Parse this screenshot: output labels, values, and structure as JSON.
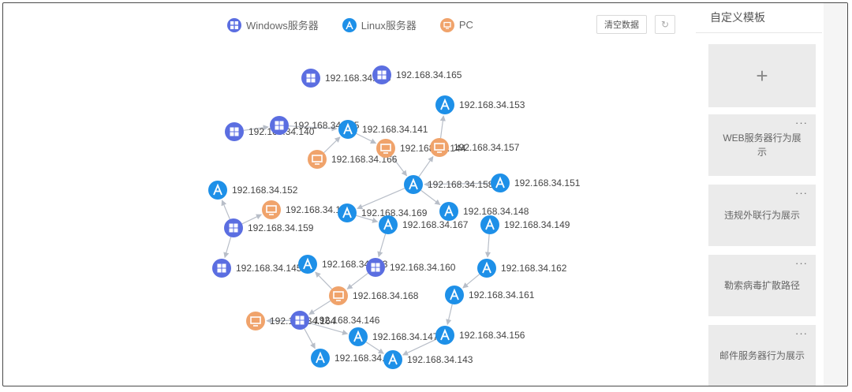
{
  "legend": {
    "windows": "Windows服务器",
    "linux": "Linux服务器",
    "pc": "PC"
  },
  "toolbar": {
    "clear_label": "清空数据",
    "refresh_icon": "refresh-icon"
  },
  "colors": {
    "windows": "#5b6ee1",
    "linux": "#1e90e8",
    "pc": "#f0a36b",
    "edge": "#b8bec8"
  },
  "sidebar": {
    "title": "自定义模板",
    "add_icon": "plus-icon",
    "more_icon": "ellipsis-icon",
    "templates": [
      "WEB服务器行为展示",
      "违规外联行为展示",
      "勒索病毒扩散路径",
      "邮件服务器行为展示"
    ]
  },
  "graph": {
    "nodes": [
      {
        "id": "n1",
        "type": "windows",
        "label": "192.168.34.165"
      },
      {
        "id": "n2",
        "type": "windows",
        "label": "192.168.34.165"
      },
      {
        "id": "n3",
        "type": "linux",
        "label": "192.168.34.153"
      },
      {
        "id": "n4",
        "type": "windows",
        "label": "192.168.34.140"
      },
      {
        "id": "n5",
        "type": "windows",
        "label": "192.168.34.155"
      },
      {
        "id": "n6",
        "type": "linux",
        "label": "192.168.34.141"
      },
      {
        "id": "n7",
        "type": "pc",
        "label": "192.168.34.166"
      },
      {
        "id": "n8",
        "type": "pc",
        "label": "192.168.34.144"
      },
      {
        "id": "n9",
        "type": "pc",
        "label": "192.168.34.157"
      },
      {
        "id": "n10",
        "type": "linux",
        "label": "192.168.34.152"
      },
      {
        "id": "n11",
        "type": "linux",
        "label": "192.168.34.158"
      },
      {
        "id": "n12",
        "type": "linux",
        "label": "192.168.34.151"
      },
      {
        "id": "n13",
        "type": "pc",
        "label": "192.168.34.142"
      },
      {
        "id": "n14",
        "type": "linux",
        "label": "192.168.34.169"
      },
      {
        "id": "n15",
        "type": "linux",
        "label": "192.168.34.148"
      },
      {
        "id": "n16",
        "type": "windows",
        "label": "192.168.34.159"
      },
      {
        "id": "n17",
        "type": "linux",
        "label": "192.168.34.167"
      },
      {
        "id": "n18",
        "type": "linux",
        "label": "192.168.34.149"
      },
      {
        "id": "n19",
        "type": "windows",
        "label": "192.168.34.145"
      },
      {
        "id": "n20",
        "type": "linux",
        "label": "192.168.34.163"
      },
      {
        "id": "n21",
        "type": "windows",
        "label": "192.168.34.160"
      },
      {
        "id": "n22",
        "type": "linux",
        "label": "192.168.34.162"
      },
      {
        "id": "n23",
        "type": "pc",
        "label": "192.168.34.168"
      },
      {
        "id": "n24",
        "type": "linux",
        "label": "192.168.34.161"
      },
      {
        "id": "n25",
        "type": "pc",
        "label": "192.168.34.164"
      },
      {
        "id": "n26",
        "type": "windows",
        "label": "192.168.34.146"
      },
      {
        "id": "n27",
        "type": "linux",
        "label": "192.168.34.147"
      },
      {
        "id": "n28",
        "type": "linux",
        "label": "192.168.34.156"
      },
      {
        "id": "n29",
        "type": "linux",
        "label": "192.168.34.154"
      },
      {
        "id": "n30",
        "type": "linux",
        "label": "192.168.34.143"
      }
    ]
  }
}
